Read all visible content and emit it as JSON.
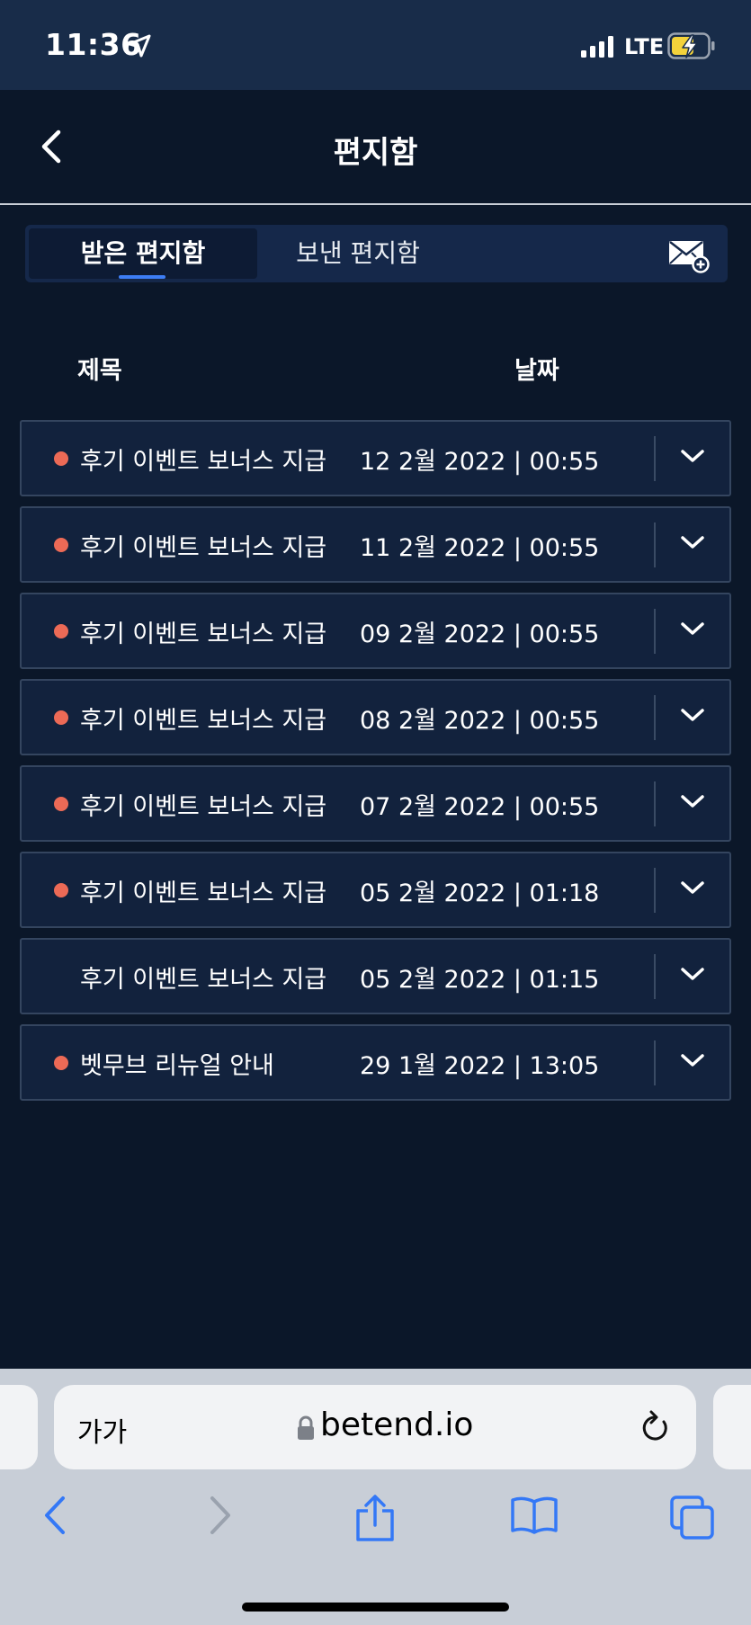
{
  "status_bar": {
    "time": "11:36",
    "network": "LTE",
    "icons": [
      "location-arrow-icon",
      "signal-bars-icon",
      "battery-charging-icon"
    ]
  },
  "header": {
    "title": "편지함",
    "back_icon": "chevron-left-icon"
  },
  "tabs": [
    {
      "label": "받은 편지함",
      "active": true
    },
    {
      "label": "보낸 편지함",
      "active": false
    }
  ],
  "compose_icon": "envelope-plus-icon",
  "columns": {
    "subject": "제목",
    "date": "날짜"
  },
  "messages": [
    {
      "subject": "후기 이벤트 보너스 지급",
      "date": "12 2월 2022 | 00:55",
      "unread": true
    },
    {
      "subject": "후기 이벤트 보너스 지급",
      "date": "11 2월 2022 | 00:55",
      "unread": true
    },
    {
      "subject": "후기 이벤트 보너스 지급",
      "date": "09 2월 2022 | 00:55",
      "unread": true
    },
    {
      "subject": "후기 이벤트 보너스 지급",
      "date": "08 2월 2022 | 00:55",
      "unread": true
    },
    {
      "subject": "후기 이벤트 보너스 지급",
      "date": "07 2월 2022 | 00:55",
      "unread": true
    },
    {
      "subject": "후기 이벤트 보너스 지급",
      "date": "05 2월 2022 | 01:18",
      "unread": true
    },
    {
      "subject": "후기 이벤트 보너스 지급",
      "date": "05 2월 2022 | 01:15",
      "unread": false
    },
    {
      "subject": "벳무브 리뉴얼 안내",
      "date": "29 1월 2022 | 13:05",
      "unread": true
    }
  ],
  "browser": {
    "text_size_label": "가가",
    "url": "betend.io",
    "toolbar_icons": [
      "back-arrow-icon",
      "forward-arrow-icon",
      "share-icon",
      "bookmarks-icon",
      "tabs-icon"
    ]
  },
  "colors": {
    "background": "#0b1729",
    "status_bar": "#182c49",
    "row_background": "#12223d",
    "unread_dot": "#ec6a56",
    "accent": "#3d7df4",
    "safari_blue": "#3478f6"
  }
}
